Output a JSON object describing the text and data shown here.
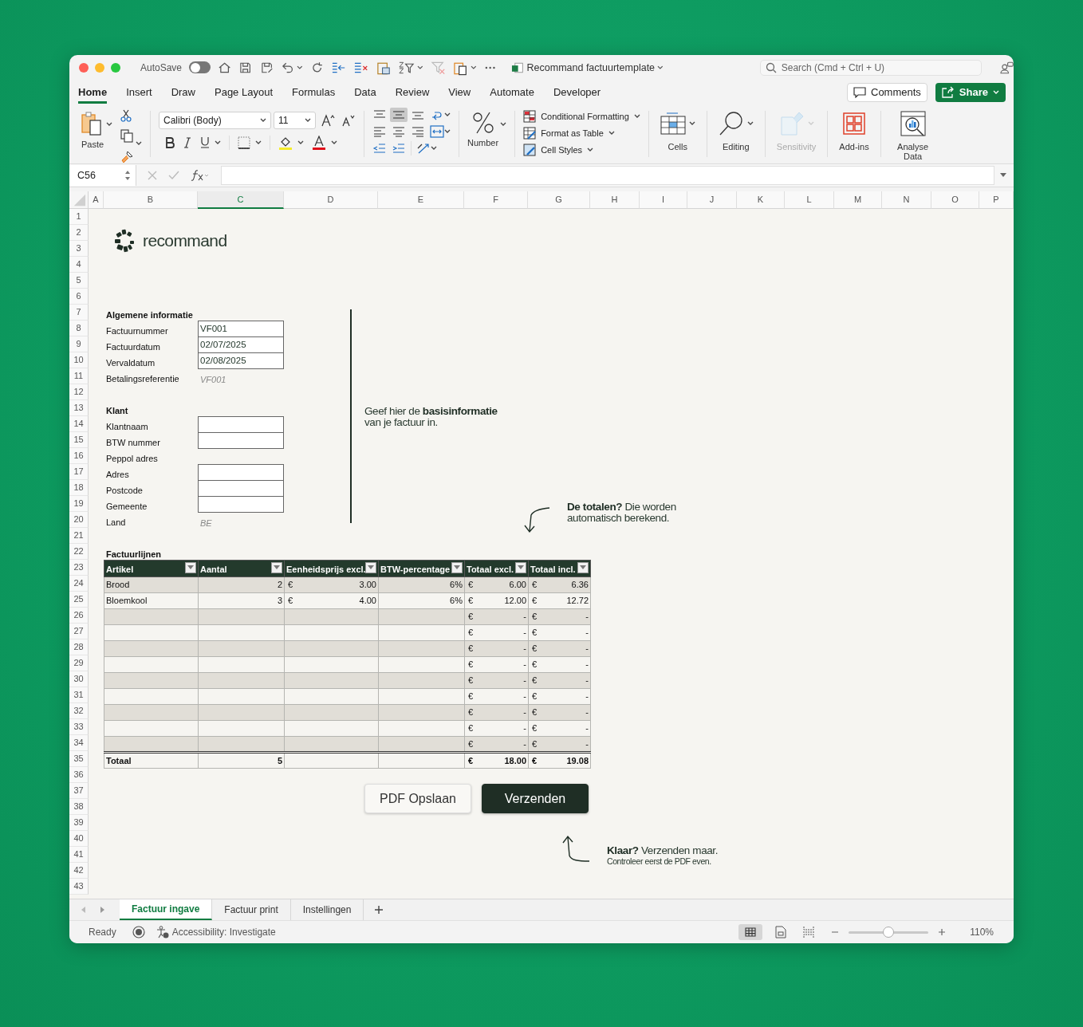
{
  "window": {
    "title": "Recommand factuurtemplate",
    "autosave": {
      "label": "AutoSave",
      "on": false
    },
    "search": {
      "placeholder": "Search (Cmd + Ctrl + U)"
    }
  },
  "ribbon_tabs": [
    {
      "label": "Home",
      "selected": true
    },
    {
      "label": "Insert",
      "selected": false
    },
    {
      "label": "Draw",
      "selected": false
    },
    {
      "label": "Page Layout",
      "selected": false
    },
    {
      "label": "Formulas",
      "selected": false
    },
    {
      "label": "Data",
      "selected": false
    },
    {
      "label": "Review",
      "selected": false
    },
    {
      "label": "View",
      "selected": false
    },
    {
      "label": "Automate",
      "selected": false
    },
    {
      "label": "Developer",
      "selected": false
    }
  ],
  "ribbon_buttons": {
    "comments": "Comments",
    "share": "Share"
  },
  "ribbon": {
    "paste": "Paste",
    "font": "Calibri (Body)",
    "font_size": "11",
    "number": "Number",
    "styles": [
      "Conditional Formatting",
      "Format as Table",
      "Cell Styles"
    ],
    "groups": [
      {
        "kind": "cells",
        "label": "Cells",
        "disabled": false
      },
      {
        "kind": "editing",
        "label": "Editing",
        "disabled": false
      },
      {
        "kind": "sensitivity",
        "label": "Sensitivity",
        "disabled": true
      },
      {
        "kind": "addins",
        "label": "Add-ins",
        "disabled": false
      },
      {
        "kind": "analyse",
        "label": "Analyse Data",
        "disabled": false
      }
    ]
  },
  "formula_bar": {
    "name_box": "C56"
  },
  "columns": [
    {
      "label": "A",
      "selected": false
    },
    {
      "label": "B",
      "selected": false
    },
    {
      "label": "C",
      "selected": true
    },
    {
      "label": "D",
      "selected": false
    },
    {
      "label": "E",
      "selected": false
    },
    {
      "label": "F",
      "selected": false
    },
    {
      "label": "G",
      "selected": false
    },
    {
      "label": "H",
      "selected": false
    },
    {
      "label": "I",
      "selected": false
    },
    {
      "label": "J",
      "selected": false
    },
    {
      "label": "K",
      "selected": false
    },
    {
      "label": "L",
      "selected": false
    },
    {
      "label": "M",
      "selected": false
    },
    {
      "label": "N",
      "selected": false
    },
    {
      "label": "O",
      "selected": false
    },
    {
      "label": "P",
      "selected": false
    }
  ],
  "rows": [
    "1",
    "2",
    "3",
    "4",
    "5",
    "6",
    "7",
    "8",
    "9",
    "10",
    "11",
    "12",
    "13",
    "14",
    "15",
    "16",
    "17",
    "18",
    "19",
    "20",
    "21",
    "22",
    "23",
    "24",
    "25",
    "26",
    "27",
    "28",
    "29",
    "30",
    "31",
    "32",
    "33",
    "34",
    "35",
    "36",
    "37",
    "38",
    "39",
    "40",
    "41",
    "42",
    "43"
  ],
  "logo": {
    "text": "recommand"
  },
  "sections": [
    {
      "title": "Algemene informatie",
      "fields": [
        {
          "label": "Factuurnummer",
          "kind": "input",
          "value": "VF001"
        },
        {
          "label": "Factuurdatum",
          "kind": "input",
          "value": "02/07/2025"
        },
        {
          "label": "Vervaldatum",
          "kind": "input",
          "value": "02/08/2025"
        },
        {
          "label": "Betalingsreferentie",
          "kind": "hint",
          "value": "VF001"
        }
      ]
    },
    {
      "title": "Klant",
      "fields": [
        {
          "label": "Klantnaam",
          "kind": "input"
        },
        {
          "label": "BTW nummer",
          "kind": "input"
        },
        {
          "label": "Peppol adres",
          "kind": "plain"
        },
        {
          "label": "Adres",
          "kind": "input"
        },
        {
          "label": "Postcode",
          "kind": "input"
        },
        {
          "label": "Gemeente",
          "kind": "input"
        },
        {
          "label": "Land",
          "kind": "hint",
          "value": "BE"
        }
      ]
    }
  ],
  "callouts": [
    {
      "kind": "plain",
      "lines": [
        "Geef hier de **basisinformatie**",
        "van je factuur in."
      ]
    },
    {
      "kind": "arrow-down",
      "lines": [
        "**De totalen?** Die worden",
        "automatisch berekend."
      ]
    },
    {
      "kind": "arrow-up",
      "lines": [
        "**Klaar?** Verzenden maar.",
        "Controleer eerst de PDF even."
      ]
    }
  ],
  "table": {
    "title": "Factuurlijnen",
    "columns": [
      "Artikel",
      "Aantal",
      "Eenheidsprijs excl.",
      "BTW-percentage",
      "Totaal excl.",
      "Totaal incl."
    ],
    "rows": [
      [
        "Brood",
        "2",
        {
          "currency": "€",
          "amount": "3.00"
        },
        "6%",
        {
          "currency": "€",
          "amount": "6.00"
        },
        {
          "currency": "€",
          "amount": "6.36"
        }
      ],
      [
        "Bloemkool",
        "3",
        {
          "currency": "€",
          "amount": "4.00"
        },
        "6%",
        {
          "currency": "€",
          "amount": "12.00"
        },
        {
          "currency": "€",
          "amount": "12.72"
        }
      ],
      [
        null,
        null,
        null,
        null,
        {
          "currency": "€",
          "amount": "-"
        },
        {
          "currency": "€",
          "amount": "-"
        }
      ],
      [
        null,
        null,
        null,
        null,
        {
          "currency": "€",
          "amount": "-"
        },
        {
          "currency": "€",
          "amount": "-"
        }
      ],
      [
        null,
        null,
        null,
        null,
        {
          "currency": "€",
          "amount": "-"
        },
        {
          "currency": "€",
          "amount": "-"
        }
      ],
      [
        null,
        null,
        null,
        null,
        {
          "currency": "€",
          "amount": "-"
        },
        {
          "currency": "€",
          "amount": "-"
        }
      ],
      [
        null,
        null,
        null,
        null,
        {
          "currency": "€",
          "amount": "-"
        },
        {
          "currency": "€",
          "amount": "-"
        }
      ],
      [
        null,
        null,
        null,
        null,
        {
          "currency": "€",
          "amount": "-"
        },
        {
          "currency": "€",
          "amount": "-"
        }
      ],
      [
        null,
        null,
        null,
        null,
        {
          "currency": "€",
          "amount": "-"
        },
        {
          "currency": "€",
          "amount": "-"
        }
      ],
      [
        null,
        null,
        null,
        null,
        {
          "currency": "€",
          "amount": "-"
        },
        {
          "currency": "€",
          "amount": "-"
        }
      ],
      [
        null,
        null,
        null,
        null,
        {
          "currency": "€",
          "amount": "-"
        },
        {
          "currency": "€",
          "amount": "-"
        }
      ]
    ],
    "total": {
      "label": "Totaal",
      "quantity": "5",
      "total_excl": {
        "currency": "€",
        "amount": "18.00"
      },
      "total_incl": {
        "currency": "€",
        "amount": "19.08"
      }
    }
  },
  "actions": [
    {
      "label": "PDF Opslaan",
      "kind": "secondary"
    },
    {
      "label": "Verzenden",
      "kind": "primary"
    }
  ],
  "sheet_tabs": [
    {
      "label": "Factuur ingave",
      "selected": true
    },
    {
      "label": "Factuur print",
      "selected": false
    },
    {
      "label": "Instellingen",
      "selected": false
    }
  ],
  "status_bar": {
    "status": "Ready",
    "accessibility": "Accessibility: Investigate",
    "zoom": "110%",
    "level": 0.5
  }
}
